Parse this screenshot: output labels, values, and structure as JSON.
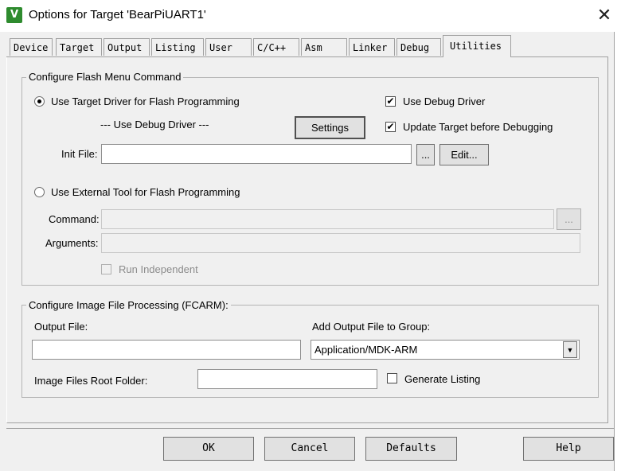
{
  "window": {
    "title": "Options for Target 'BearPiUART1'",
    "icon_letter": "V",
    "icon": "uvision-app-icon",
    "close_glyph": "✕"
  },
  "tabs": [
    {
      "label": "Device"
    },
    {
      "label": "Target"
    },
    {
      "label": "Output"
    },
    {
      "label": "Listing"
    },
    {
      "label": "User"
    },
    {
      "label": "C/C++"
    },
    {
      "label": "Asm"
    },
    {
      "label": "Linker"
    },
    {
      "label": "Debug"
    },
    {
      "label": "Utilities",
      "active": true
    }
  ],
  "flash_group": {
    "title": "Configure Flash Menu Command",
    "use_target_driver_label": "Use Target Driver for Flash Programming",
    "use_target_driver_selected": true,
    "driver_value": "--- Use Debug Driver ---",
    "settings_label": "Settings",
    "use_debug_driver_label": "Use Debug Driver",
    "use_debug_driver_checked": true,
    "update_target_label": "Update Target before Debugging",
    "update_target_checked": true,
    "init_file_label": "Init File:",
    "init_file_value": "",
    "browse_label": "...",
    "edit_label": "Edit...",
    "use_external_label": "Use External Tool for Flash Programming",
    "use_external_selected": false,
    "command_label": "Command:",
    "command_value": "",
    "command_browse_label": "...",
    "arguments_label": "Arguments:",
    "arguments_value": "",
    "run_independent_label": "Run Independent",
    "run_independent_checked": false,
    "check_glyph": "✔"
  },
  "image_group": {
    "title": "Configure Image File Processing (FCARM):",
    "output_file_label": "Output File:",
    "output_file_value": "",
    "add_output_label": "Add Output File  to Group:",
    "group_selected": "Application/MDK-ARM",
    "dropdown_glyph": "▼",
    "root_folder_label": "Image Files Root Folder:",
    "root_folder_value": "",
    "generate_listing_label": "Generate Listing",
    "generate_listing_checked": false
  },
  "footer": {
    "ok_label": "OK",
    "cancel_label": "Cancel",
    "defaults_label": "Defaults",
    "help_label": "Help"
  },
  "colors": {
    "dialog_bg": "#f0f0f0",
    "border": "#a0a0a0",
    "icon_green": "#2e8b2e"
  }
}
